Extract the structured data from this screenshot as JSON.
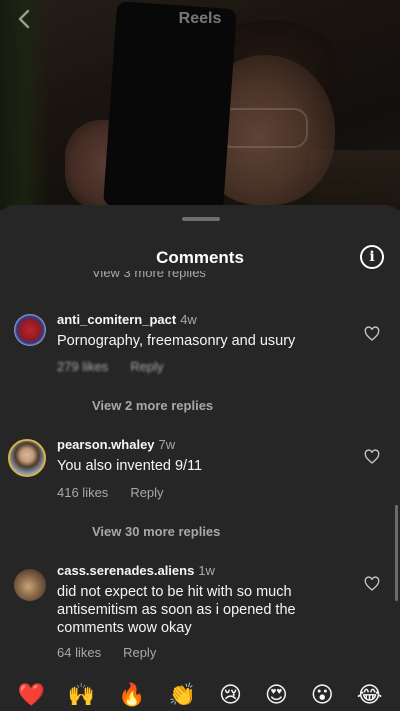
{
  "top_bar": {
    "title": "Reels"
  },
  "sheet": {
    "title": "Comments",
    "clipped_reply_text": "View 3 more replies"
  },
  "comments": [
    {
      "username": "anti_comitern_pact",
      "time": "4w",
      "text": "Pornography, freemasonry and usury",
      "likes": "279 likes",
      "reply": "Reply",
      "view_more": "View 2 more replies"
    },
    {
      "username": "pearson.whaley",
      "time": "7w",
      "text": "You also invented 9/11",
      "likes": "416 likes",
      "reply": "Reply",
      "view_more": "View 30 more replies"
    },
    {
      "username": "cass.serenades.aliens",
      "time": "1w",
      "text": "did not expect to be hit with so much antisemitism as soon as i opened the comments wow okay",
      "likes": "64 likes",
      "reply": "Reply"
    }
  ],
  "emojis": [
    "❤️",
    "🙌",
    "🔥",
    "👏",
    "😢",
    "😍",
    "😮",
    "😂"
  ],
  "colors": {
    "sheet_bg": "#262626",
    "secondary_text": "#a8a8a8",
    "primary_text": "#f5f5f5"
  }
}
